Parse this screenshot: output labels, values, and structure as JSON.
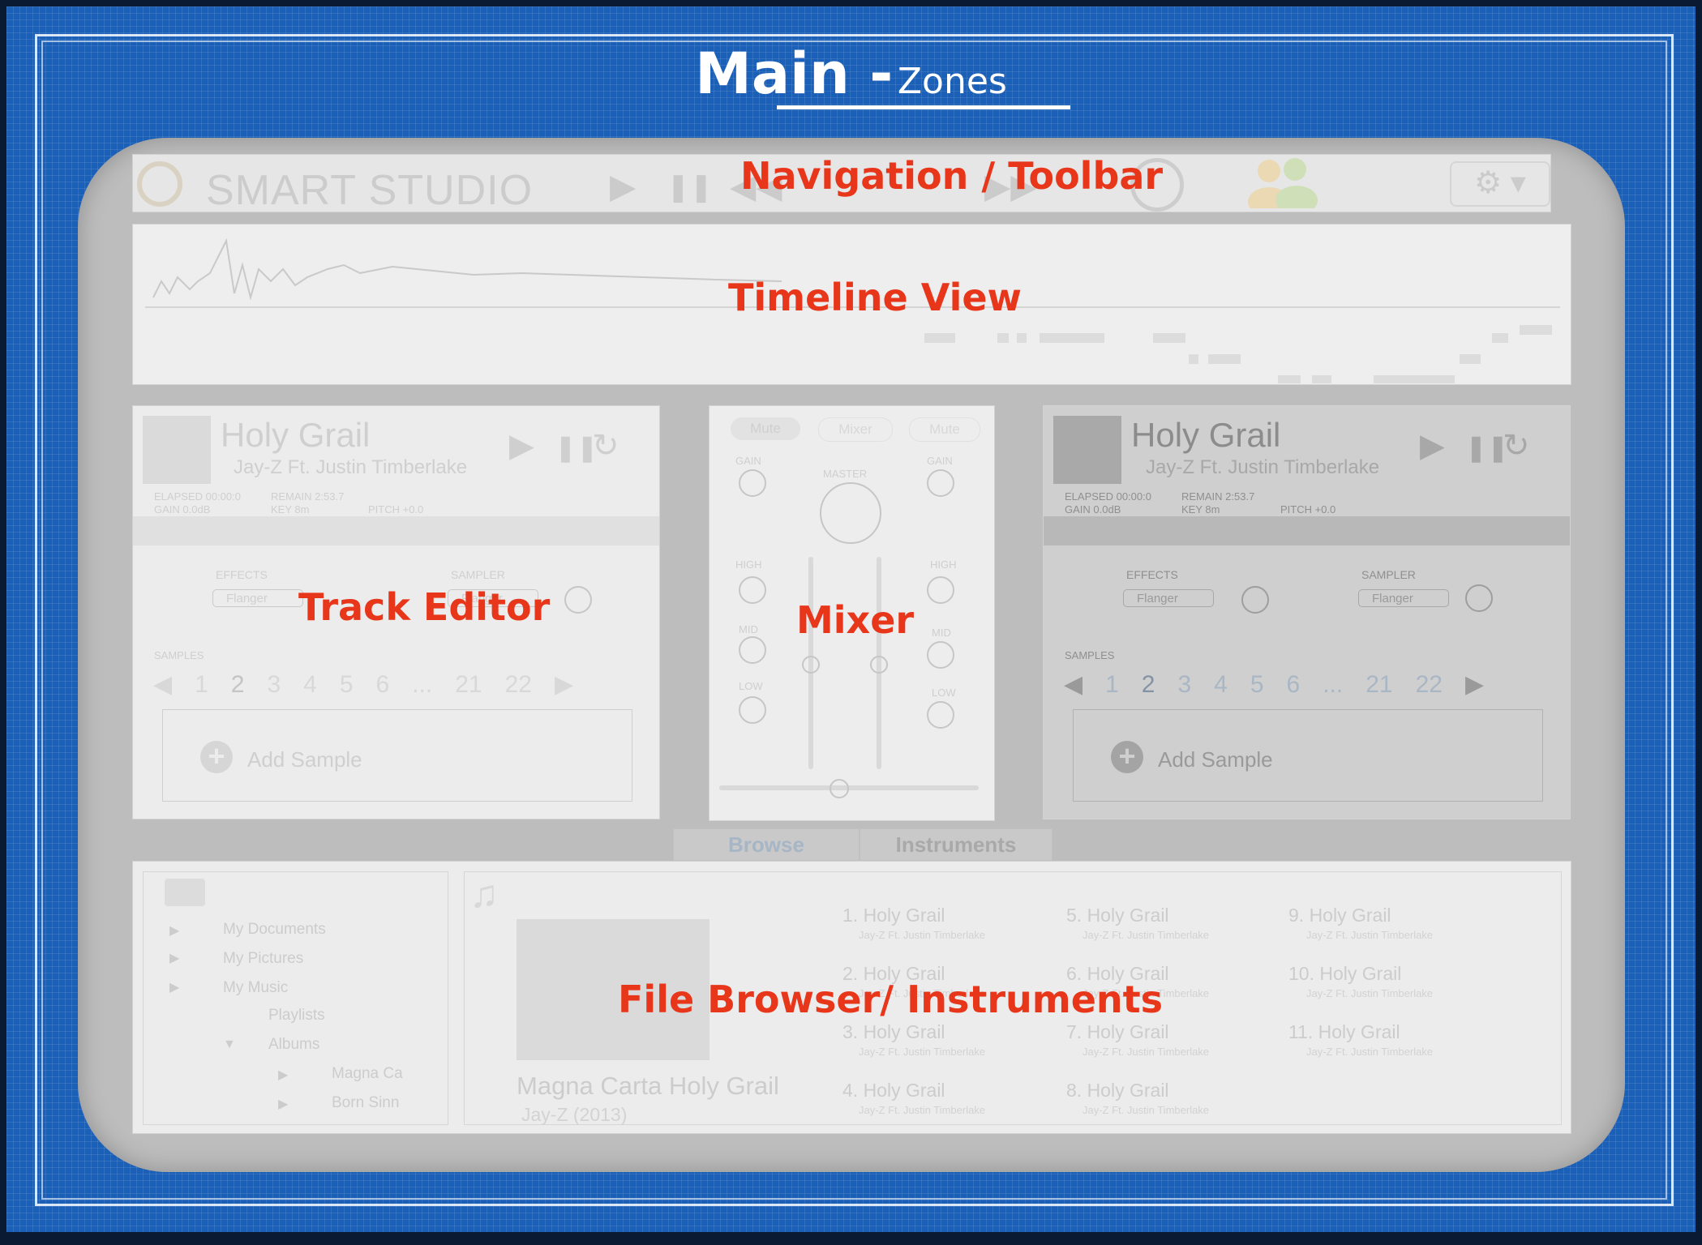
{
  "header": {
    "title_main": "Main -",
    "title_sub": "Zones"
  },
  "zones": {
    "toolbar": "Navigation / Toolbar",
    "timeline": "Timeline View",
    "track_editor": "Track Editor",
    "mixer": "Mixer",
    "browser": "File Browser/ Instruments"
  },
  "toolbar": {
    "app_name": "SMART STUDIO",
    "play": "▶",
    "pause": "❚❚",
    "rewind": "◀◀",
    "forward": "▶▶",
    "gear": "⚙ ▾"
  },
  "track": {
    "title": "Holy Grail",
    "artist": "Jay-Z Ft. Justin Timberlake",
    "elapsed": "ELAPSED 00:00:0",
    "remain": "REMAIN 2:53.7",
    "gain": "GAIN 0.0dB",
    "key": "KEY 8m",
    "pitch": "PITCH +0.0",
    "effects_label": "EFFECTS",
    "sampler_label": "SAMPLER",
    "effect_value": "Flanger",
    "sampler_value": "Flanger",
    "samples_label": "SAMPLES",
    "sample_numbers": [
      "1",
      "2",
      "3",
      "4",
      "5",
      "6",
      "...",
      "21",
      "22"
    ],
    "add_sample": "Add Sample",
    "play": "▶",
    "pause": "❚❚",
    "reset": "↻"
  },
  "mixer": {
    "btn_mute_left": "Mute",
    "btn_mixer": "Mixer",
    "btn_mute_right": "Mute",
    "gain": "GAIN",
    "master": "MASTER",
    "high": "HIGH",
    "mid": "MID",
    "low": "LOW"
  },
  "tabs": {
    "browse": "Browse",
    "instruments": "Instruments"
  },
  "browser": {
    "tree": [
      {
        "label": "My Documents"
      },
      {
        "label": "My Pictures"
      },
      {
        "label": "My Music"
      },
      {
        "label": "Playlists"
      },
      {
        "label": "Albums"
      },
      {
        "label": "Magna Ca"
      },
      {
        "label": "Born Sinn"
      }
    ],
    "album_title": "Magna Carta Holy Grail",
    "album_artist": "Jay-Z (2013)",
    "songs": [
      {
        "title": "1. Holy Grail",
        "artist": "Jay-Z Ft. Justin Timberlake"
      },
      {
        "title": "2. Holy Grail",
        "artist": "Jay-Z Ft. Justin Timberlake"
      },
      {
        "title": "3. Holy Grail",
        "artist": "Jay-Z Ft. Justin Timberlake"
      },
      {
        "title": "4. Holy Grail",
        "artist": "Jay-Z Ft. Justin Timberlake"
      },
      {
        "title": "5. Holy Grail",
        "artist": "Jay-Z Ft. Justin Timberlake"
      },
      {
        "title": "6. Holy Grail",
        "artist": "Jay-Z Ft. Justin Timberlake"
      },
      {
        "title": "7. Holy Grail",
        "artist": "Jay-Z Ft. Justin Timberlake"
      },
      {
        "title": "8. Holy Grail",
        "artist": "Jay-Z Ft. Justin Timberlake"
      },
      {
        "title": "9. Holy Grail",
        "artist": "Jay-Z Ft. Justin Timberlake"
      },
      {
        "title": "10. Holy Grail",
        "artist": "Jay-Z Ft. Justin Timberlake"
      },
      {
        "title": "11. Holy Grail",
        "artist": "Jay-Z Ft. Justin Timberlake"
      }
    ]
  },
  "colors": {
    "blueprint": "#1a5fb8",
    "zone_label": "#e8361b",
    "device": "#bdbdbd"
  }
}
